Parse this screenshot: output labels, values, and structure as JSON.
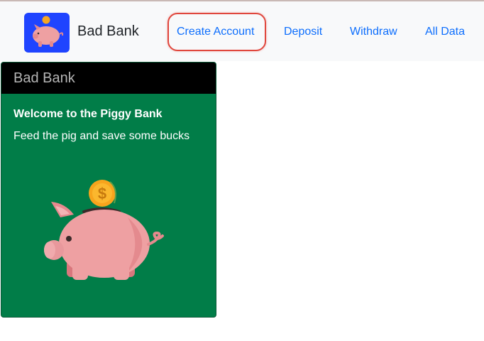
{
  "navbar": {
    "brand": "Bad Bank",
    "logo_icon": "piggy-bank-icon",
    "links": [
      {
        "label": "Create Account",
        "highlighted": true
      },
      {
        "label": "Deposit"
      },
      {
        "label": "Withdraw"
      },
      {
        "label": "All Data"
      }
    ]
  },
  "card": {
    "header": "Bad Bank",
    "title": "Welcome to the Piggy Bank",
    "text": "Feed the pig and save some bucks",
    "image_icon": "piggy-bank-with-coin-icon",
    "coin_symbol": "$"
  },
  "colors": {
    "link": "#0d6efd",
    "card_background": "#017d48",
    "card_header": "#000000",
    "highlight_ring": "#e0463c",
    "logo_background": "#1f44ff"
  }
}
